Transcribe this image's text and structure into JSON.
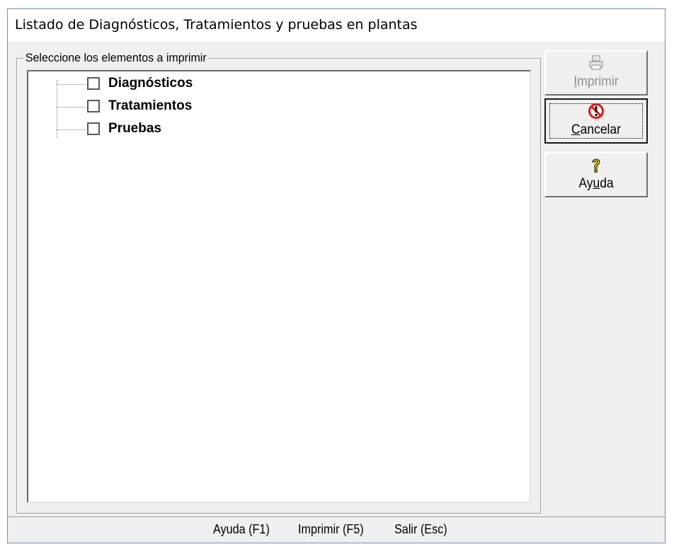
{
  "window": {
    "title": "Listado de Diagnósticos, Tratamientos y pruebas en plantas"
  },
  "group": {
    "legend": "Seleccione los elementos a imprimir"
  },
  "tree": {
    "items": [
      {
        "label": "Diagnósticos",
        "checked": false
      },
      {
        "label": "Tratamientos",
        "checked": false
      },
      {
        "label": "Pruebas",
        "checked": false
      }
    ]
  },
  "buttons": {
    "print": {
      "label": "Imprimir",
      "hotkey": "I",
      "enabled": false,
      "icon": "printer-icon"
    },
    "cancel": {
      "label": "Cancelar",
      "hotkey": "C",
      "enabled": true,
      "default": true,
      "icon": "stop-icon"
    },
    "help": {
      "label": "Ayuda",
      "hotkey": "u",
      "enabled": true,
      "icon": "question-icon"
    }
  },
  "status": {
    "help": "Ayuda (F1)",
    "print": "Imprimir (F5)",
    "exit": "Salir (Esc)"
  },
  "colors": {
    "window_border": "#6e8fb5",
    "face": "#f0f0f0",
    "stop_red": "#e01818",
    "help_yellow": "#f5e10a"
  }
}
